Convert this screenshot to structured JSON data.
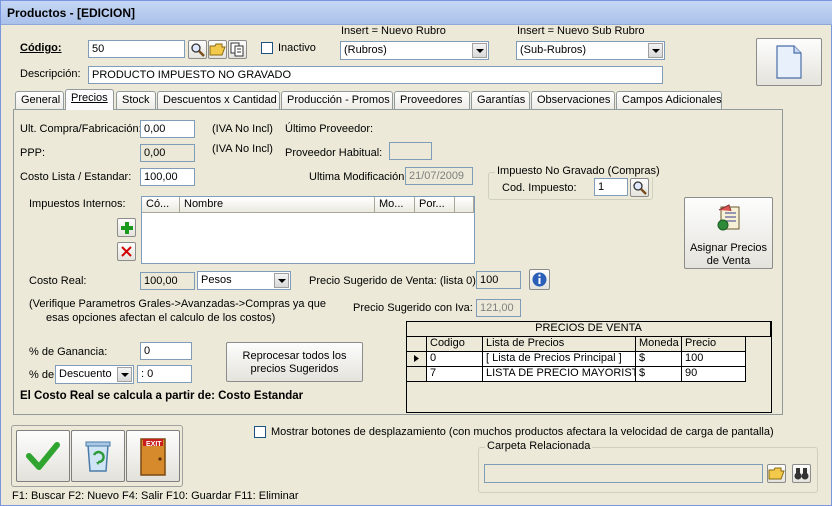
{
  "window": {
    "title": "Productos - [EDICION]"
  },
  "header": {
    "codigo_label": "Código:",
    "codigo_value": "50",
    "inactivo_label": "Inactivo",
    "rubro_caption": "Insert = Nuevo Rubro",
    "rubro_value": "(Rubros)",
    "subrubro_caption": "Insert = Nuevo Sub Rubro",
    "subrubro_value": "(Sub-Rubros)",
    "descripcion_label": "Descripción:",
    "descripcion_value": "PRODUCTO IMPUESTO NO GRAVADO"
  },
  "tabs": [
    {
      "label": "General"
    },
    {
      "label": "Precios"
    },
    {
      "label": "Stock"
    },
    {
      "label": "Descuentos x Cantidad"
    },
    {
      "label": "Producción - Promos"
    },
    {
      "label": "Proveedores"
    },
    {
      "label": "Garantías"
    },
    {
      "label": "Observaciones"
    },
    {
      "label": "Campos Adicionales"
    }
  ],
  "precios": {
    "ult_compra_label": "Ult. Compra/Fabricación:",
    "ult_compra_value": "0,00",
    "iva_no_incl_1": "(IVA No Incl)",
    "ultimo_proveedor_label": "Último Proveedor:",
    "ppp_label": "PPP:",
    "ppp_value": "0,00",
    "iva_no_incl_2": "(IVA No Incl)",
    "proveedor_habitual_label": "Proveedor Habitual:",
    "costo_lista_label": "Costo Lista / Estandar:",
    "costo_lista_value": "100,00",
    "ultima_mod_label": "Ultima Modificación:",
    "ultima_mod_value": "21/07/2009",
    "impuesto_group_title": "Impuesto No Gravado (Compras)",
    "cod_impuesto_label": "Cod. Impuesto:",
    "cod_impuesto_value": "1",
    "impuestos_internos_label": "Impuestos Internos:",
    "impuestos_columns": [
      "Có...",
      "Nombre",
      "Mo...",
      "Por..."
    ],
    "asignar_precios_label_1": "Asignar Precios",
    "asignar_precios_label_2": "de Venta",
    "costo_real_label": "Costo Real:",
    "costo_real_value": "100,00",
    "moneda_value": "Pesos",
    "precio_sugerido_label": "Precio Sugerido de Venta: (lista 0)",
    "precio_sugerido_value": "100",
    "verifique_line1": "(Verifique Parametros Grales->Avanzadas->Compras ya que",
    "verifique_line2": "esas opciones afectan el calculo de los costos)",
    "precio_iva_label": "Precio Sugerido con Iva:",
    "precio_iva_value": "121,00",
    "ganancia_label": "% de Ganancia:",
    "ganancia_value": "0",
    "de_label": "% de",
    "descuento_value": "Descuento",
    "descuento_amount": ": 0",
    "reprocesar_line1": "Reprocesar todos los",
    "reprocesar_line2": "precios Sugeridos",
    "costo_real_note": "El Costo Real se calcula a partir de: Costo Estandar"
  },
  "precios_venta": {
    "title": "PRECIOS DE VENTA",
    "columns": [
      "Codigo",
      "Lista  de  Precios",
      "Moneda",
      "Precio"
    ],
    "rows": [
      {
        "codigo": "0",
        "lista": "[ Lista de Precios Principal ]",
        "moneda": "$",
        "precio": "100"
      },
      {
        "codigo": "7",
        "lista": "LISTA DE PRECIO MAYORISTA",
        "moneda": "$",
        "precio": "90"
      }
    ]
  },
  "footer": {
    "mostrar_label": "Mostrar botones de desplazamiento  (con muchos productos afectara la velocidad de carga de pantalla)",
    "carpeta_label": "Carpeta Relacionada",
    "exit_text": "EXIT",
    "shortcuts": "F1: Buscar  F2: Nuevo  F4: Salir  F10: Guardar  F11: Eliminar"
  },
  "colors": {
    "accept": "#2fa52f",
    "delete_cross": "#d00000",
    "add_plus": "#1a9a1a",
    "info": "#2c5fb8"
  }
}
